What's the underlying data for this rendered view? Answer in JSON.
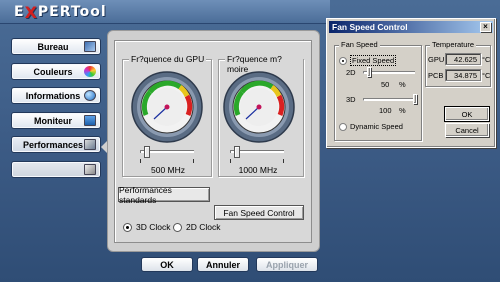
{
  "app": {
    "logo": {
      "text": "EXPERTool",
      "initial": "E",
      "accent_letter": "X",
      "rest": "PERTool"
    }
  },
  "nav": {
    "items": [
      {
        "label": "Bureau",
        "icon": "desktop-icon"
      },
      {
        "label": "Couleurs",
        "icon": "color-palette-icon"
      },
      {
        "label": "Informations",
        "icon": "info-globe-icon"
      },
      {
        "label": "Moniteur",
        "icon": "monitor-icon"
      },
      {
        "label": "Performances",
        "icon": "performance-icon",
        "active": true
      },
      {
        "label": "",
        "icon": "extra-icon"
      }
    ]
  },
  "performance": {
    "gpu": {
      "title": "Fr?quence du GPU",
      "value": "500 MHz",
      "level": 0.0
    },
    "memory": {
      "title": "Fr?quence m?moire",
      "value": "1000 MHz",
      "level": 0.0
    },
    "standard_button": "Performances standards",
    "fan_button": "Fan Speed Control",
    "clock_3d": "3D Clock",
    "clock_2d": "2D Clock",
    "selected_clock": "3D Clock"
  },
  "footer": {
    "ok": "OK",
    "cancel": "Annuler",
    "apply": "Appliquer"
  },
  "fan_dialog": {
    "title": "Fan Speed Control",
    "close_glyph": "×",
    "fan_speed": {
      "group_title": "Fan Speed",
      "fixed_label": "Fixed Speed",
      "dynamic_label": "Dynamic Speed",
      "selected": "Fixed Speed",
      "speed_2d": {
        "label": "2D",
        "value": "50",
        "unit": "%",
        "level": 0.5
      },
      "speed_3d": {
        "label": "3D",
        "value": "100",
        "unit": "%",
        "level": 1.0
      }
    },
    "temperature": {
      "group_title": "Temperature",
      "gpu_label": "GPU :",
      "gpu_value": "42.625",
      "pcb_label": "PCB :",
      "pcb_value": "34.875",
      "unit": "°C"
    },
    "ok": "OK",
    "cancel": "Cancel"
  },
  "colors": {
    "background": "#3b5a84",
    "panel": "#cfcfcf",
    "dialog_title": "#0a246a",
    "gauge_ring": "#5a6c84"
  }
}
